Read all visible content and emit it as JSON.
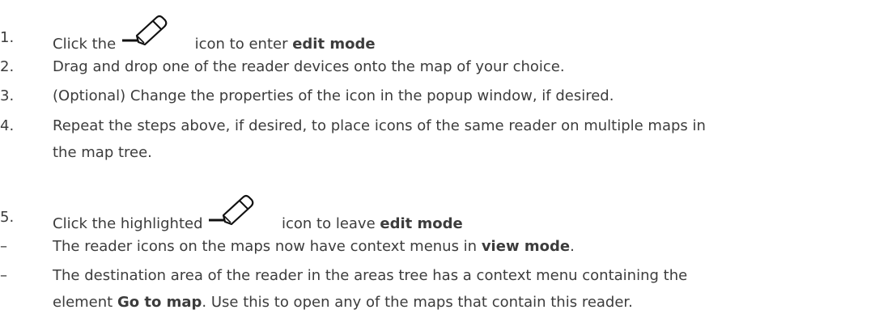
{
  "steps": [
    {
      "number": "1.",
      "pre": "Click the",
      "mid": "icon to enter",
      "bold": "edit mode"
    },
    {
      "number": "2.",
      "text": "Drag and drop one of the reader devices onto the map of your choice."
    },
    {
      "number": "3.",
      "text": "(Optional) Change the properties of the icon in the popup window, if desired."
    },
    {
      "number": "4.",
      "line1": "Repeat the steps above, if desired, to place icons of the same reader on multiple maps in",
      "line2": "the map tree."
    },
    {
      "number": "5.",
      "pre": "Click the highlighted",
      "mid": "icon to leave",
      "bold": "edit mode"
    }
  ],
  "notes": [
    {
      "dash": "–",
      "pre": "The reader icons on the maps now have context menus in",
      "bold": "view mode",
      "post": "."
    },
    {
      "dash": "–",
      "line1": "The destination area of the reader in the areas tree has a context menu containing the",
      "pre2": "element",
      "bold": "Go to map",
      "post2": ". Use this to open any of the maps that contain this reader."
    }
  ],
  "icons": {
    "edit": "edit-pencil-icon"
  }
}
